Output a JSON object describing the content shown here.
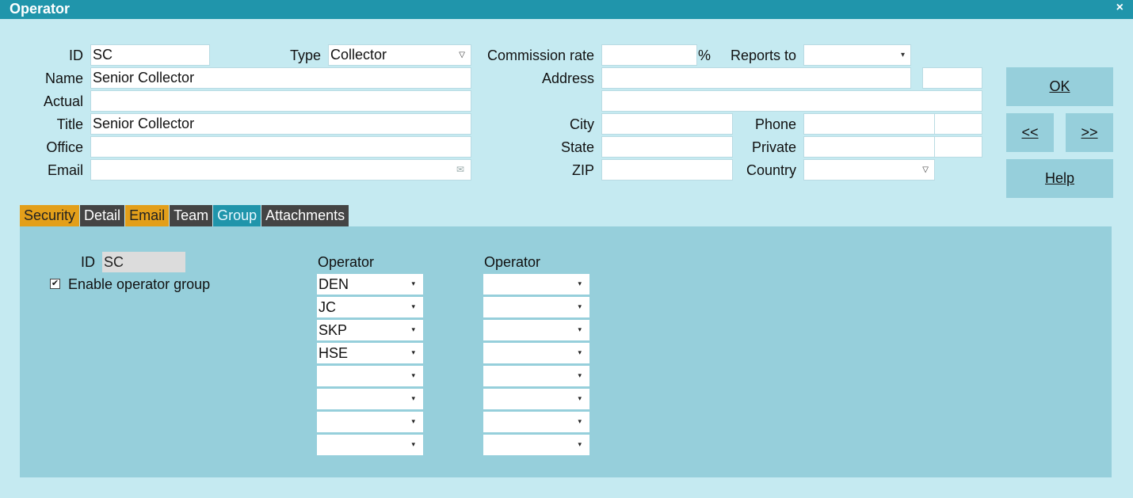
{
  "window": {
    "title": "Operator",
    "close_glyph": "×"
  },
  "form": {
    "id_label": "ID",
    "id_value": "SC",
    "type_label": "Type",
    "type_value": "Collector",
    "commission_label": "Commission rate",
    "commission_value": "",
    "commission_unit": "%",
    "reports_to_label": "Reports to",
    "reports_to_value": "",
    "name_label": "Name",
    "name_value": "Senior Collector",
    "address_label": "Address",
    "address_line1": "",
    "address_extra": "",
    "address_line2": "",
    "actual_label": "Actual",
    "actual_value": "",
    "title_label": "Title",
    "title_value": "Senior Collector",
    "city_label": "City",
    "city_value": "",
    "phone_label": "Phone",
    "phone_value": "",
    "phone_ext": "",
    "office_label": "Office",
    "office_value": "",
    "state_label": "State",
    "state_value": "",
    "private_label": "Private",
    "private_value": "",
    "private_ext": "",
    "email_label": "Email",
    "email_value": "",
    "zip_label": "ZIP",
    "zip_value": "",
    "country_label": "Country",
    "country_value": ""
  },
  "buttons": {
    "ok": "OK",
    "prev": "<<",
    "next": ">>",
    "help": "Help"
  },
  "tabs": [
    {
      "label": "Security",
      "style": "orange"
    },
    {
      "label": "Detail",
      "style": "dark"
    },
    {
      "label": "Email",
      "style": "orange"
    },
    {
      "label": "Team",
      "style": "dark"
    },
    {
      "label": "Group",
      "style": "active"
    },
    {
      "label": "Attachments",
      "style": "dark"
    }
  ],
  "group": {
    "id_label": "ID",
    "id_value": "SC",
    "enable_label": "Enable operator group",
    "enable_checked": true,
    "col1_header": "Operator",
    "col2_header": "Operator",
    "col1": [
      "DEN",
      "JC",
      "SKP",
      "HSE",
      "",
      "",
      "",
      ""
    ],
    "col2": [
      "",
      "",
      "",
      "",
      "",
      "",
      "",
      ""
    ]
  },
  "colors": {
    "titlebar": "#2095ab",
    "background": "#c5eaf1",
    "panel": "#96cfdb",
    "tab_orange": "#e39f1a",
    "tab_dark": "#444444"
  }
}
